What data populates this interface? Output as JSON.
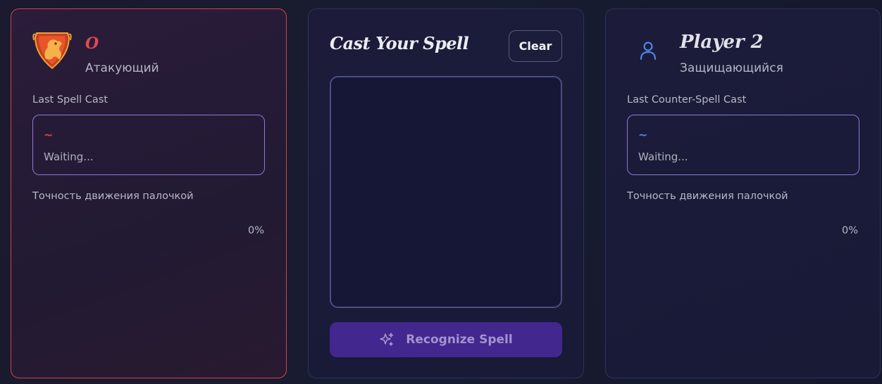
{
  "player1": {
    "name": "O",
    "role": "Атакующий",
    "last_cast_label": "Last Spell Cast",
    "cast_symbol": "~",
    "cast_status": "Waiting...",
    "accuracy_label": "Точность движения палочкой",
    "accuracy_value": "0%",
    "accent_color": "#e0404a",
    "avatar_icon": "gryffindor-crest-icon"
  },
  "center": {
    "title": "Cast Your Spell",
    "clear_label": "Clear",
    "recognize_label": "Recognize Spell",
    "recognize_icon": "sparkles-icon"
  },
  "player2": {
    "name": "Player 2",
    "role": "Защищающийся",
    "last_cast_label": "Last Counter-Spell Cast",
    "cast_symbol": "~",
    "cast_status": "Waiting...",
    "accuracy_label": "Точность движения палочкой",
    "accuracy_value": "0%",
    "accent_color": "#4b86e8",
    "avatar_icon": "user-icon"
  }
}
